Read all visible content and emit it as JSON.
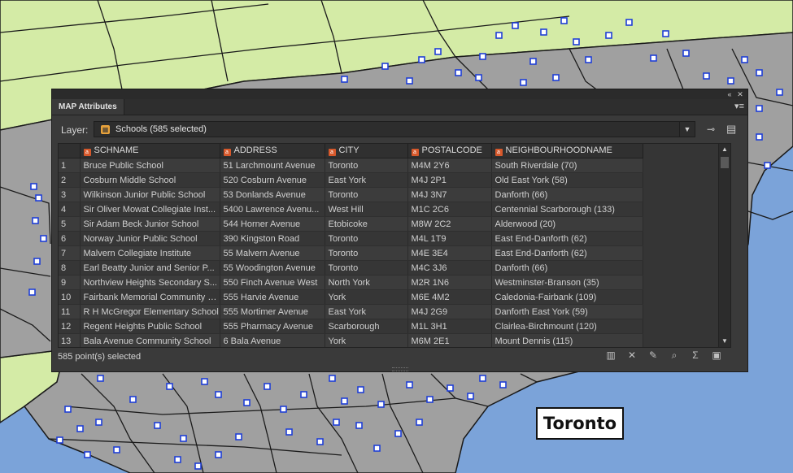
{
  "map": {
    "city_label": "Toronto",
    "water_color": "#7ba3d9",
    "land_city_color": "#a0a0a0",
    "land_outer_color": "#d4eba6",
    "school_marker_color": "#1f3fd6"
  },
  "panel": {
    "tab_title": "MAP Attributes",
    "layer_label": "Layer:",
    "layer_value": "Schools (585 selected)",
    "columns": [
      "SCHNAME",
      "ADDRESS",
      "CITY",
      "POSTALCODE",
      "NEIGHBOURHOODNAME"
    ],
    "rows": [
      {
        "n": "1",
        "name": "Bruce Public School",
        "address": "51 Larchmount Avenue",
        "city": "Toronto",
        "postal": "M4M 2Y6",
        "hood": "South Riverdale (70)"
      },
      {
        "n": "2",
        "name": "Cosburn Middle School",
        "address": "520 Cosburn Avenue",
        "city": "East York",
        "postal": "M4J 2P1",
        "hood": "Old East York (58)"
      },
      {
        "n": "3",
        "name": "Wilkinson Junior Public School",
        "address": "53 Donlands Avenue",
        "city": "Toronto",
        "postal": "M4J 3N7",
        "hood": "Danforth (66)"
      },
      {
        "n": "4",
        "name": "Sir Oliver Mowat Collegiate Inst...",
        "address": "5400 Lawrence Avenu...",
        "city": "West Hill",
        "postal": "M1C 2C6",
        "hood": "Centennial Scarborough (133)"
      },
      {
        "n": "5",
        "name": "Sir Adam Beck Junior School",
        "address": "544 Horner Avenue",
        "city": "Etobicoke",
        "postal": "M8W 2C2",
        "hood": "Alderwood (20)"
      },
      {
        "n": "6",
        "name": "Norway Junior Public School",
        "address": "390 Kingston Road",
        "city": "Toronto",
        "postal": "M4L 1T9",
        "hood": "East End-Danforth (62)"
      },
      {
        "n": "7",
        "name": "Malvern Collegiate Institute",
        "address": "55 Malvern Avenue",
        "city": "Toronto",
        "postal": "M4E 3E4",
        "hood": "East End-Danforth (62)"
      },
      {
        "n": "8",
        "name": "Earl Beatty Junior and Senior P...",
        "address": "55 Woodington Avenue",
        "city": "Toronto",
        "postal": "M4C 3J6",
        "hood": "Danforth (66)"
      },
      {
        "n": "9",
        "name": "Northview Heights Secondary S...",
        "address": "550 Finch Avenue West",
        "city": "North York",
        "postal": "M2R 1N6",
        "hood": "Westminster-Branson (35)"
      },
      {
        "n": "10",
        "name": "Fairbank Memorial Community S...",
        "address": "555 Harvie Avenue",
        "city": "York",
        "postal": "M6E 4M2",
        "hood": "Caledonia-Fairbank (109)"
      },
      {
        "n": "11",
        "name": "R H McGregor Elementary School",
        "address": "555 Mortimer Avenue",
        "city": "East York",
        "postal": "M4J 2G9",
        "hood": "Danforth East York (59)"
      },
      {
        "n": "12",
        "name": "Regent Heights Public School",
        "address": "555 Pharmacy Avenue",
        "city": "Scarborough",
        "postal": "M1L 3H1",
        "hood": "Clairlea-Birchmount (120)"
      },
      {
        "n": "13",
        "name": "Bala Avenue Community School",
        "address": "6 Bala Avenue",
        "city": "York",
        "postal": "M6M 2E1",
        "hood": "Mount Dennis (115)"
      }
    ],
    "status": "585 point(s) selected"
  },
  "icons": {
    "close": "close-icon",
    "collapse": "collapse-icon",
    "menu": "panel-menu-icon",
    "layer": "layer-icon",
    "dropdown": "chevron-down-icon",
    "pin": "pin-icon",
    "options": "table-options-icon",
    "status_tools": [
      "columns-icon",
      "clear-selection-icon",
      "edit-icon",
      "zoom-to-icon",
      "sum-icon",
      "clipboard-icon"
    ]
  }
}
